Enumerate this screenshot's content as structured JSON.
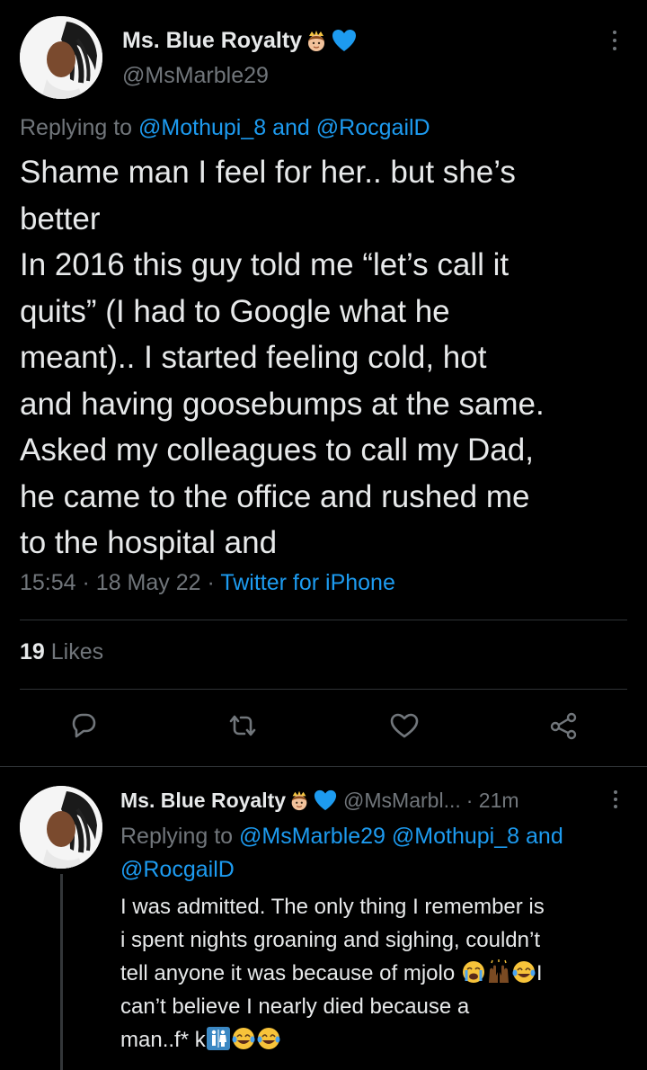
{
  "main_tweet": {
    "display_name": "Ms. Blue Royalty",
    "handle": "@MsMarble29",
    "replying_prefix": "Replying to",
    "replying_user1": "@Mothupi_8",
    "replying_and": "and",
    "replying_user2": "@RocgailD",
    "lines": [
      "Shame man I feel for her.. but she’s",
      "better",
      "In 2016 this guy told me “let’s call it",
      "quits” (I had to Google what he",
      "meant).. I started feeling cold, hot",
      "and having goosebumps at the same.",
      "Asked my colleagues to call my Dad,",
      "he came to the office and rushed me",
      "to the hospital and"
    ],
    "time": "15:54",
    "date": "18 May 22",
    "source": "Twitter for iPhone",
    "likes_count": "19",
    "likes_label": "Likes",
    "name_emojis": [
      "princess-emoji",
      "blue-heart-emoji"
    ]
  },
  "reply_tweet": {
    "display_name": "Ms. Blue Royalty",
    "handle": "@MsMarbl...",
    "time": "· 21m",
    "replying_prefix": "Replying to",
    "replying_user1": "@MsMarble29",
    "replying_user2": "@Mothupi_8",
    "replying_and": "and",
    "replying_user3": "@RocgailD",
    "lines": [
      "I was admitted. The only thing I remember is",
      "i spent nights groaning and sighing, couldn’t",
      "tell anyone it was because of mjolo",
      "can’t believe I nearly died because a",
      "man..f*"
    ],
    "line3_tail": "I",
    "line5_mid": "k",
    "emojis_line3": [
      "loudly-crying-face-emoji",
      "raising-hands-emoji",
      "tears-of-joy-emoji"
    ],
    "emojis_line5": [
      "restroom-sign-emoji",
      "tears-of-joy-emoji",
      "tears-of-joy-emoji"
    ]
  },
  "colors": {
    "background": "#000000",
    "text": "#e7e9ea",
    "muted": "#71767b",
    "link": "#1d9bf0",
    "divider": "#2f3336"
  },
  "icons": [
    "reply-icon",
    "retweet-icon",
    "like-icon",
    "share-icon",
    "more-icon",
    "verified-heart-icon"
  ]
}
